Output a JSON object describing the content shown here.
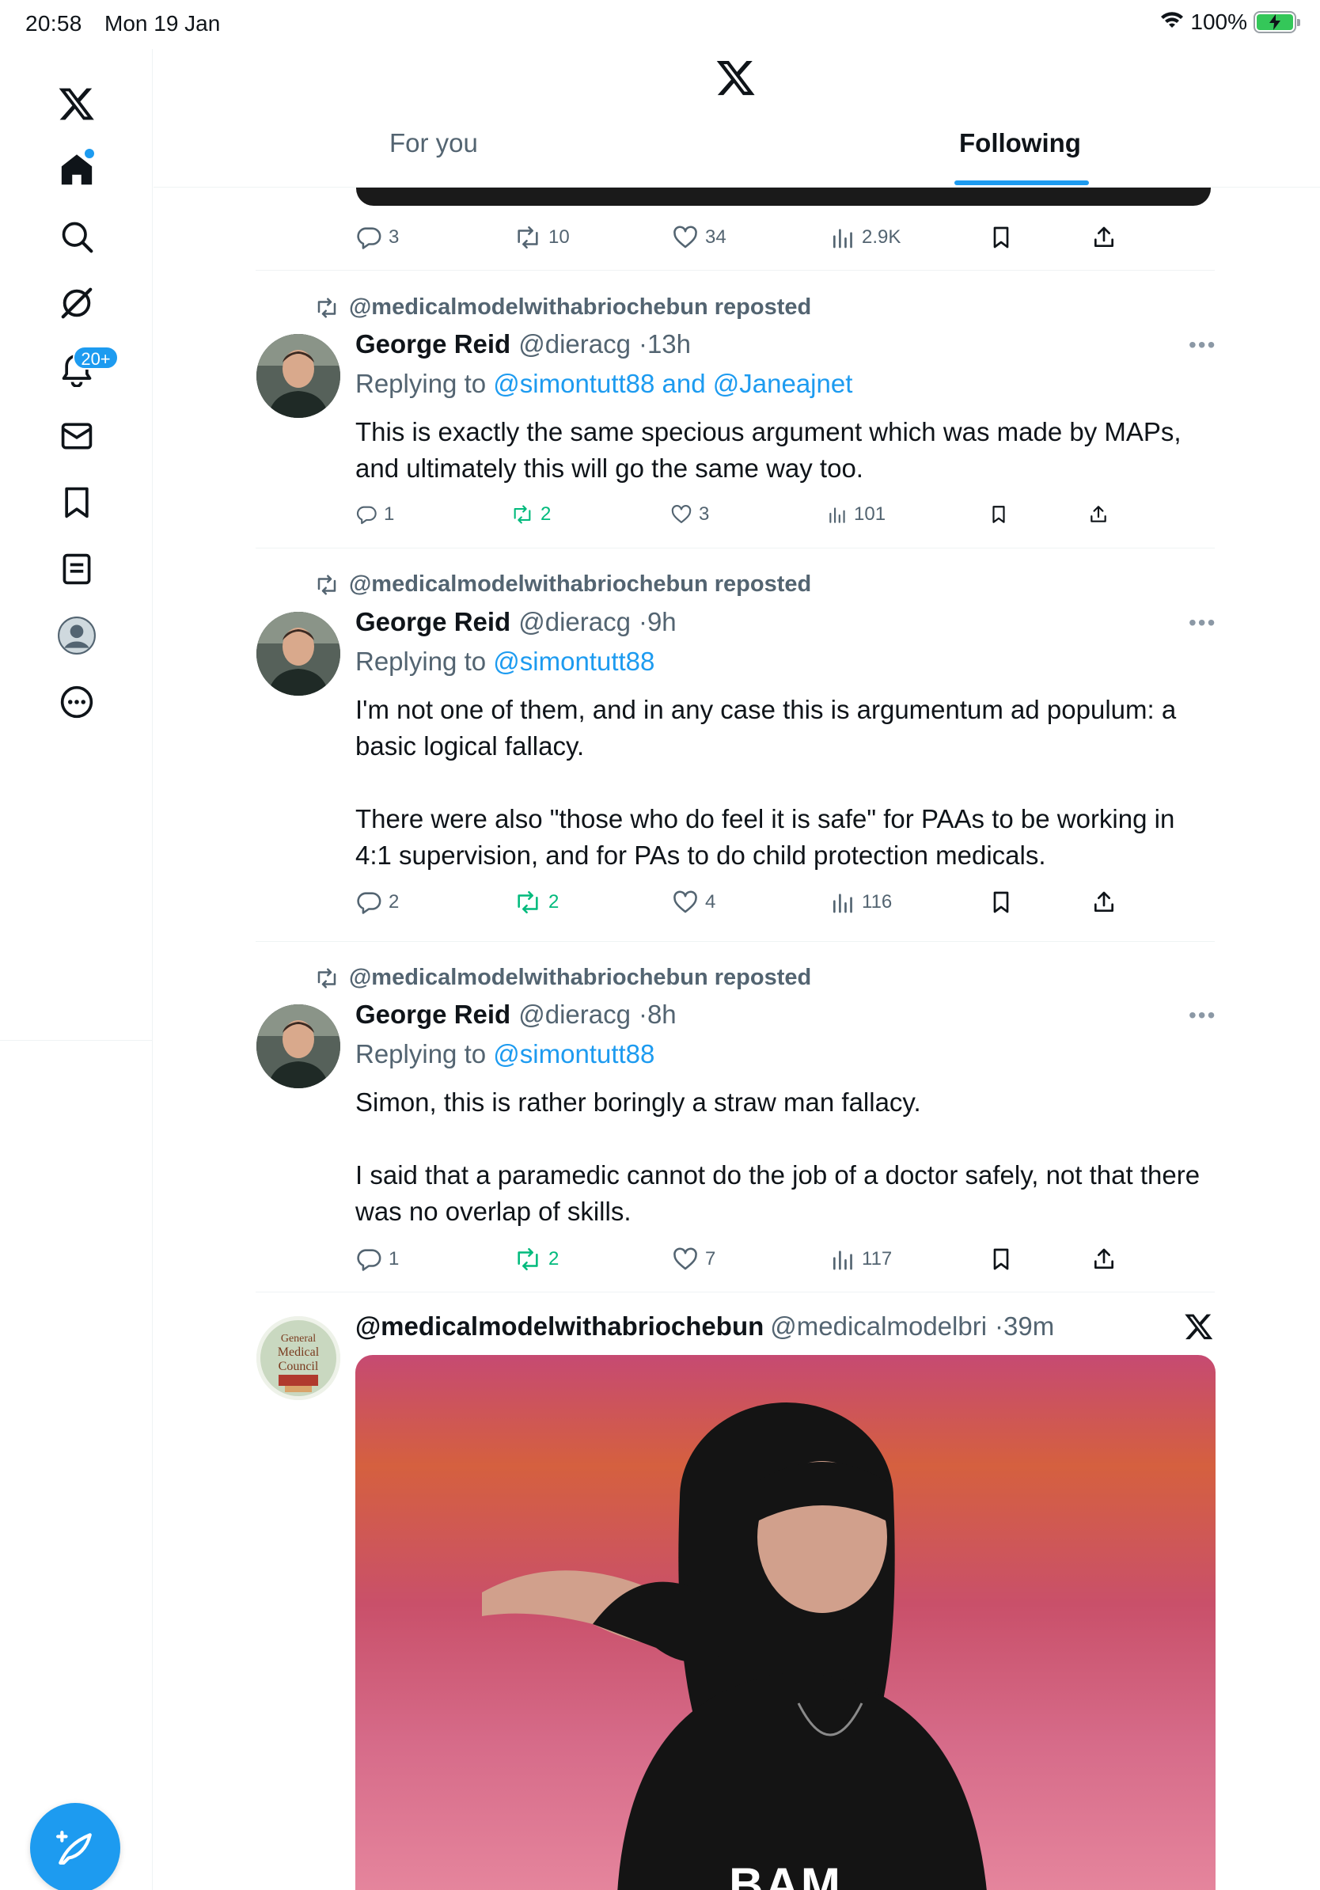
{
  "status_bar": {
    "time": "20:58",
    "date": "Mon 19 Jan",
    "battery": "100%"
  },
  "sidebar": {
    "notifications_badge": "20+",
    "items": [
      "home",
      "search",
      "grok",
      "notifications",
      "messages",
      "bookmarks",
      "lists",
      "profile",
      "more"
    ]
  },
  "header": {
    "tab_for_you": "For you",
    "tab_following": "Following"
  },
  "top_stats": {
    "replies": "3",
    "reposts": "10",
    "likes": "34",
    "views": "2.9K"
  },
  "tweets": [
    {
      "repost_label": "@medicalmodelwithabriochebun reposted",
      "name": "George Reid",
      "handle": "@dieracg",
      "time": "13h",
      "reply_prefix": "Replying to",
      "reply_to": "@simontutt88 and @Janeajnet",
      "text": "This is exactly the same specious argument which was made by MAPs, and ultimately this will go the same way too.",
      "replies": "1",
      "reposts": "2",
      "likes": "3",
      "views": "101"
    },
    {
      "repost_label": "@medicalmodelwithabriochebun reposted",
      "name": "George Reid",
      "handle": "@dieracg",
      "time": "9h",
      "reply_prefix": "Replying to",
      "reply_to": "@simontutt88",
      "text": "I'm not one of them, and in any case this is argumentum ad populum: a basic logical fallacy.\n\nThere were also \"those who do feel it is safe\" for PAAs to be working in 4:1 supervision, and for PAs to do child protection medicals.",
      "replies": "2",
      "reposts": "2",
      "likes": "4",
      "views": "116"
    },
    {
      "repost_label": "@medicalmodelwithabriochebun reposted",
      "name": "George Reid",
      "handle": "@dieracg",
      "time": "8h",
      "reply_prefix": "Replying to",
      "reply_to": "@simontutt88",
      "text": "Simon, this is rather boringly a straw man fallacy.\n\nI said that a paramedic cannot do the job of a doctor safely, not that there was no overlap of skills.",
      "replies": "1",
      "reposts": "2",
      "likes": "7",
      "views": "117"
    }
  ],
  "last_tweet": {
    "name": "@medicalmodelwithabriochebun",
    "handle": "@medicalmodelbri",
    "time": "39m",
    "avatar_text": "General Medical Council",
    "gif_caption": "BAM"
  }
}
